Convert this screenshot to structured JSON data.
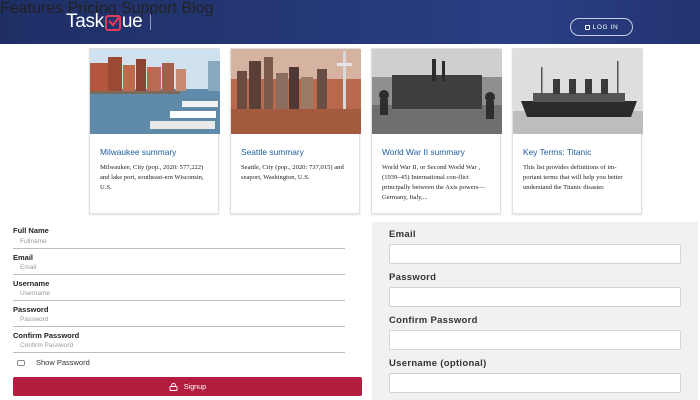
{
  "header": {
    "logo": {
      "prefix": "Task",
      "suffix": "ue"
    },
    "nav": [
      {
        "label": "Features"
      },
      {
        "label": "Pricing"
      },
      {
        "label": "Support"
      },
      {
        "label": "Blog"
      }
    ],
    "login_label": "LOG IN"
  },
  "cards": [
    {
      "title": "Milwaukee summary",
      "desc": "Milwaukee, City (pop., 2020: 577,222) and lake port, southeast-ern Wisconsin, U.S."
    },
    {
      "title": "Seattle summary",
      "desc": "Seattle, City (pop., 2020: 737,015) and seaport, Washington, U.S."
    },
    {
      "title": "World War II summary",
      "desc": "World War II, or Second World War , (1939–45) International con-flict principally between the Axis powers—Germany, Italy,..."
    },
    {
      "title": "Key Terms: Titanic",
      "desc": "This list provides definitions of im-portant terms that will help you better understand the Titanic disaster."
    }
  ],
  "left_form": {
    "fields": [
      {
        "label": "Full Name",
        "placeholder": "Fullname"
      },
      {
        "label": "Email",
        "placeholder": "Email"
      },
      {
        "label": "Username",
        "placeholder": "Username"
      },
      {
        "label": "Password",
        "placeholder": "Password"
      },
      {
        "label": "Confirm Password",
        "placeholder": "Confirm Password"
      }
    ],
    "show_password": "Show Password",
    "signup": "Signup"
  },
  "right_form": {
    "fields": [
      {
        "label": "Email"
      },
      {
        "label": "Password"
      },
      {
        "label": "Confirm Password"
      },
      {
        "label": "Username (optional)"
      }
    ]
  },
  "colors": {
    "header": "#263a7a",
    "accent": "#b21d40",
    "link": "#1e5d9c",
    "panel": "#f1f1f1"
  }
}
